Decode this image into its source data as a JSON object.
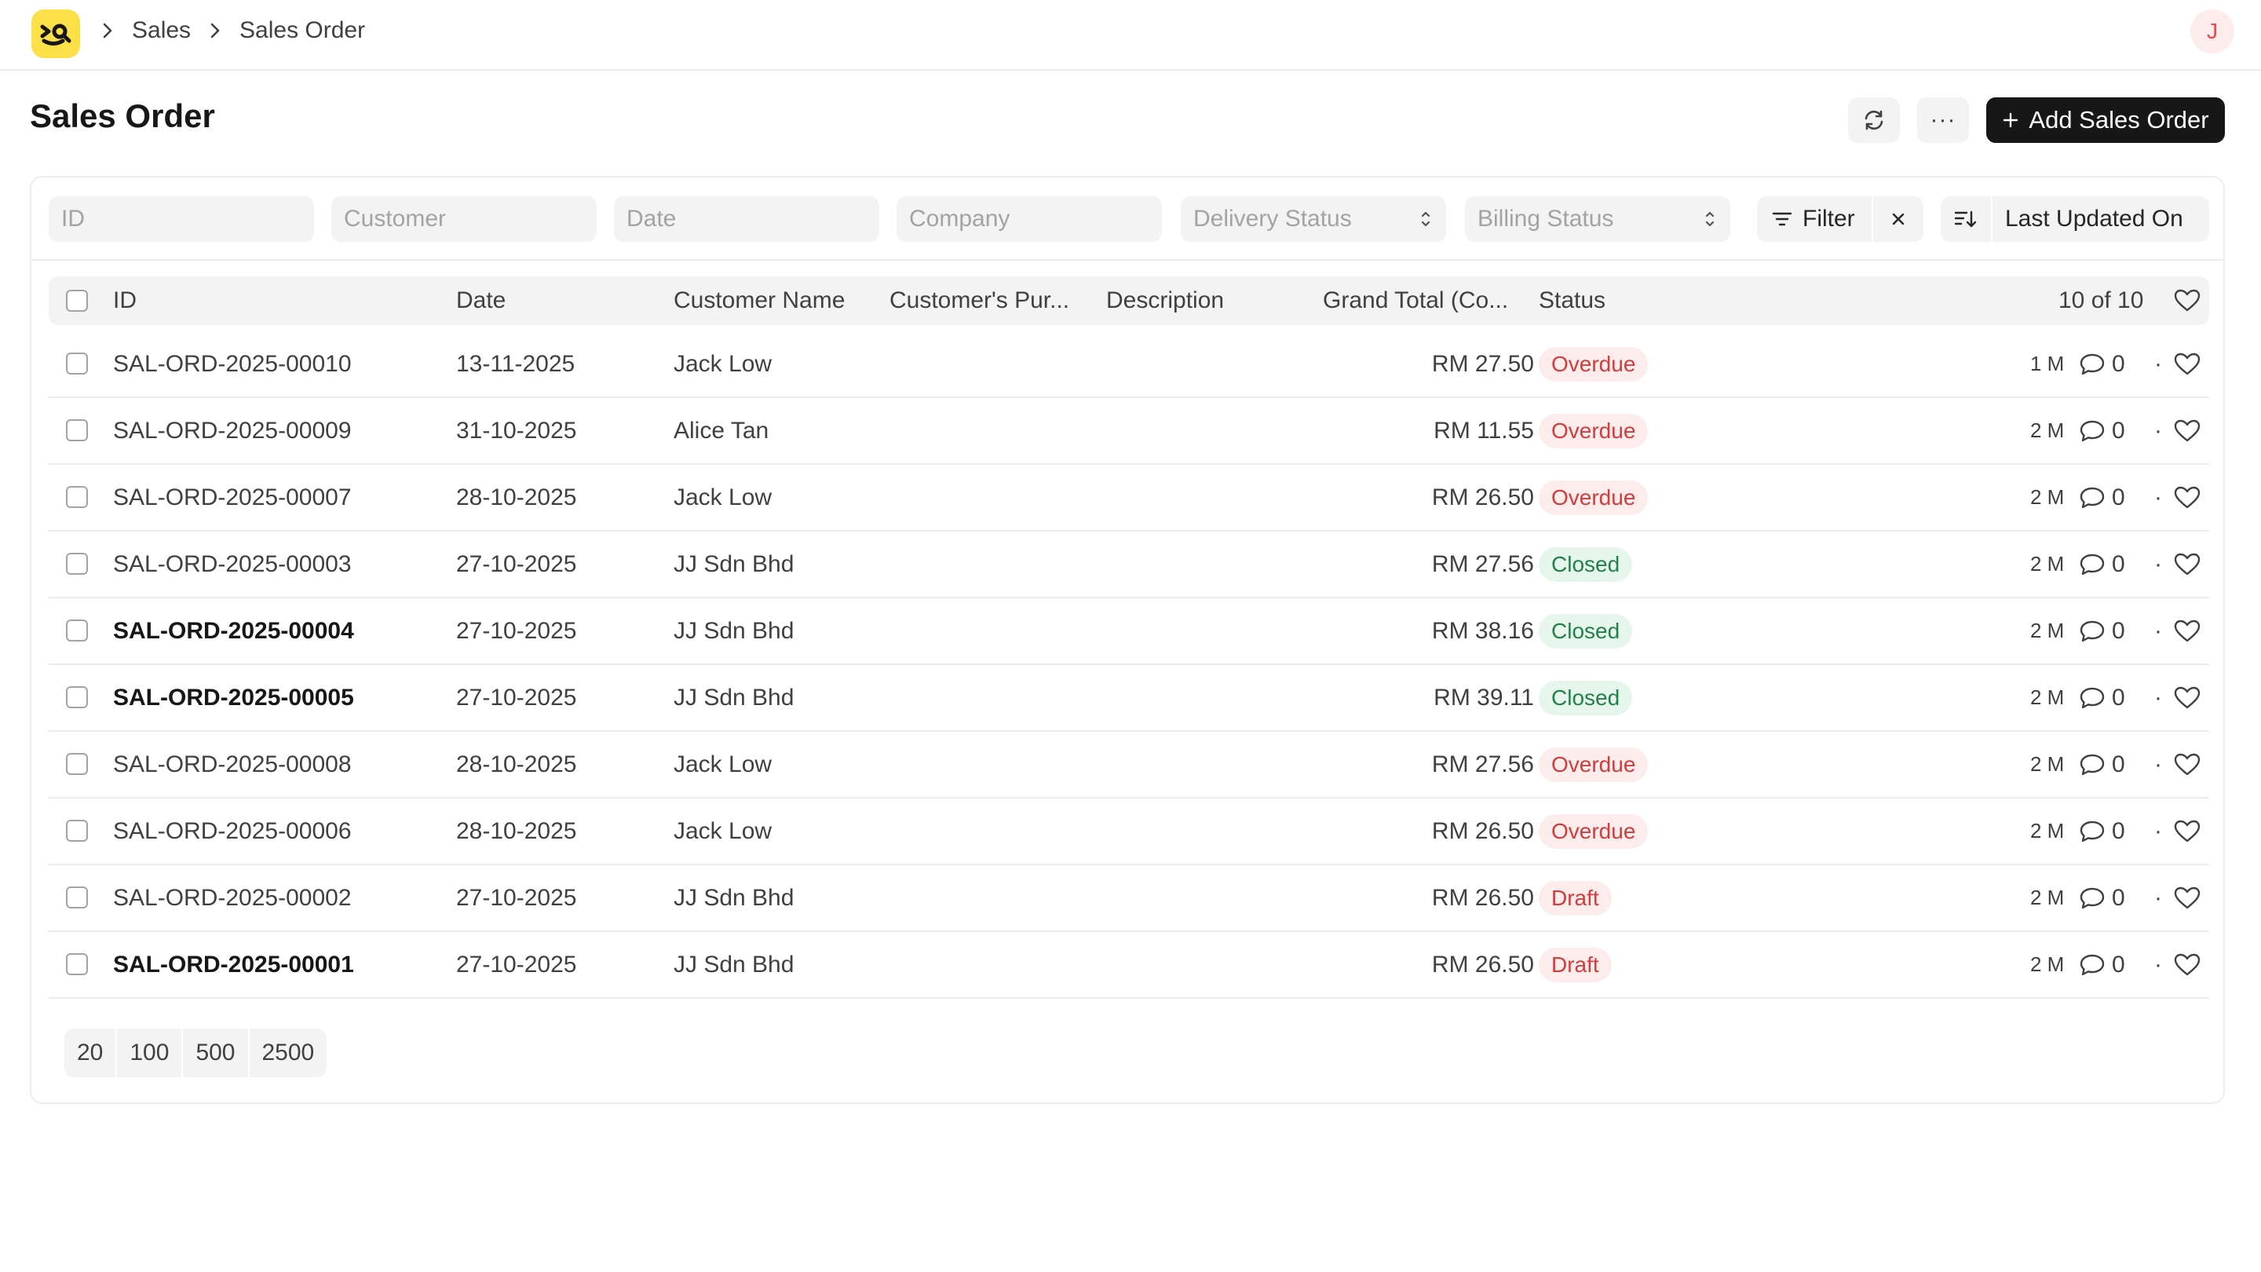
{
  "breadcrumb": [
    "Sales",
    "Sales Order"
  ],
  "user": {
    "avatar_initial": "J"
  },
  "page": {
    "title": "Sales Order",
    "add_button": "Add Sales Order",
    "more_label": "···"
  },
  "filters": {
    "id_placeholder": "ID",
    "customer_placeholder": "Customer",
    "date_placeholder": "Date",
    "company_placeholder": "Company",
    "delivery_status": "Delivery Status",
    "billing_status": "Billing Status",
    "filter_label": "Filter",
    "sort_label": "Last Updated On"
  },
  "table": {
    "columns": [
      "ID",
      "Date",
      "Customer Name",
      "Customer's Pur...",
      "Description",
      "Grand Total (Co...",
      "Status"
    ],
    "count": "10 of 10",
    "rows": [
      {
        "id": "SAL-ORD-2025-00010",
        "date": "13-11-2025",
        "customer": "Jack Low",
        "total": "RM 27.50",
        "status": "Overdue",
        "ago": "1 M",
        "comments": "0",
        "bold": false
      },
      {
        "id": "SAL-ORD-2025-00009",
        "date": "31-10-2025",
        "customer": "Alice Tan",
        "total": "RM 11.55",
        "status": "Overdue",
        "ago": "2 M",
        "comments": "0",
        "bold": false
      },
      {
        "id": "SAL-ORD-2025-00007",
        "date": "28-10-2025",
        "customer": "Jack Low",
        "total": "RM 26.50",
        "status": "Overdue",
        "ago": "2 M",
        "comments": "0",
        "bold": false
      },
      {
        "id": "SAL-ORD-2025-00003",
        "date": "27-10-2025",
        "customer": "JJ Sdn Bhd",
        "total": "RM 27.56",
        "status": "Closed",
        "ago": "2 M",
        "comments": "0",
        "bold": false
      },
      {
        "id": "SAL-ORD-2025-00004",
        "date": "27-10-2025",
        "customer": "JJ Sdn Bhd",
        "total": "RM 38.16",
        "status": "Closed",
        "ago": "2 M",
        "comments": "0",
        "bold": true
      },
      {
        "id": "SAL-ORD-2025-00005",
        "date": "27-10-2025",
        "customer": "JJ Sdn Bhd",
        "total": "RM 39.11",
        "status": "Closed",
        "ago": "2 M",
        "comments": "0",
        "bold": true
      },
      {
        "id": "SAL-ORD-2025-00008",
        "date": "28-10-2025",
        "customer": "Jack Low",
        "total": "RM 27.56",
        "status": "Overdue",
        "ago": "2 M",
        "comments": "0",
        "bold": false
      },
      {
        "id": "SAL-ORD-2025-00006",
        "date": "28-10-2025",
        "customer": "Jack Low",
        "total": "RM 26.50",
        "status": "Overdue",
        "ago": "2 M",
        "comments": "0",
        "bold": false
      },
      {
        "id": "SAL-ORD-2025-00002",
        "date": "27-10-2025",
        "customer": "JJ Sdn Bhd",
        "total": "RM 26.50",
        "status": "Draft",
        "ago": "2 M",
        "comments": "0",
        "bold": false
      },
      {
        "id": "SAL-ORD-2025-00001",
        "date": "27-10-2025",
        "customer": "JJ Sdn Bhd",
        "total": "RM 26.50",
        "status": "Draft",
        "ago": "2 M",
        "comments": "0",
        "bold": true
      }
    ]
  },
  "page_sizes": [
    "20",
    "100",
    "500",
    "2500"
  ],
  "colors": {
    "overdue_bg": "#fdecec",
    "overdue_fg": "#d23c3c",
    "closed_bg": "#e6f6ec",
    "closed_fg": "#238048",
    "draft_bg": "#fdecec",
    "draft_fg": "#d23c3c",
    "logo": "#fde047",
    "primary": "#171717"
  },
  "icons": [
    "logo-icon",
    "chevron-right-icon",
    "refresh-icon",
    "plus-icon",
    "filter-icon",
    "close-icon",
    "sort-icon",
    "heart-icon",
    "comment-icon",
    "chevron-updown-icon"
  ]
}
